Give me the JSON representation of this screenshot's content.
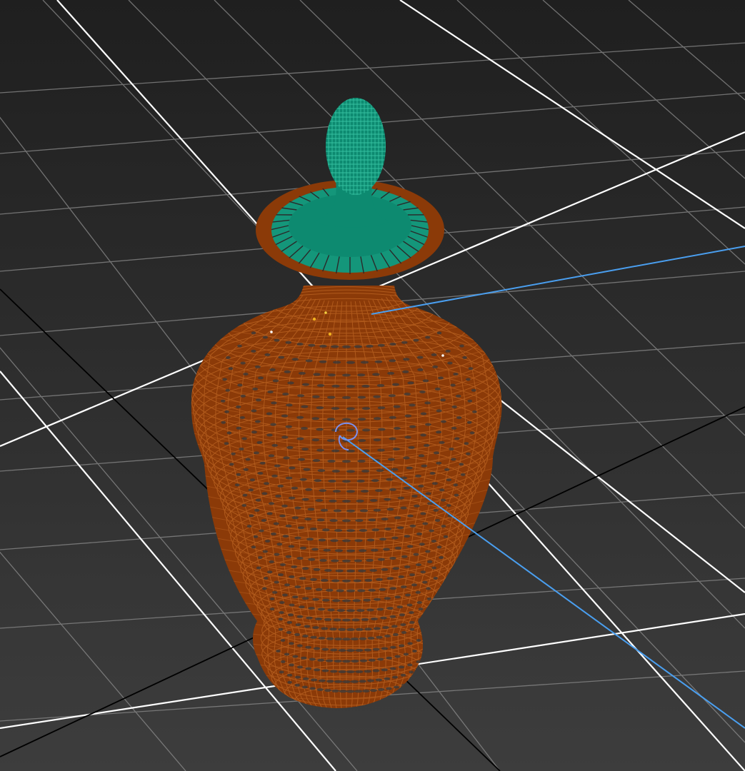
{
  "viewport": {
    "mode": "wireframe",
    "background_top": "#1f1f1f",
    "background_bottom": "#3d3d3d"
  },
  "scene": {
    "grid": {
      "minor_color": "#8c8c8c",
      "major_color": "#ffffff",
      "world_axis_color": "#000000"
    },
    "axis": {
      "color": "#4a9ff0"
    },
    "objects": [
      {
        "name": "vase-body",
        "color": "#8b3a08",
        "wire_color": "#b05a1c",
        "selected": false
      },
      {
        "name": "vase-lid",
        "color": "#0d8a70",
        "wire_color": "#35c0a0",
        "selected": false
      }
    ]
  },
  "pivot": {
    "icon": "pivot-icon",
    "color": "#7a90f0"
  }
}
